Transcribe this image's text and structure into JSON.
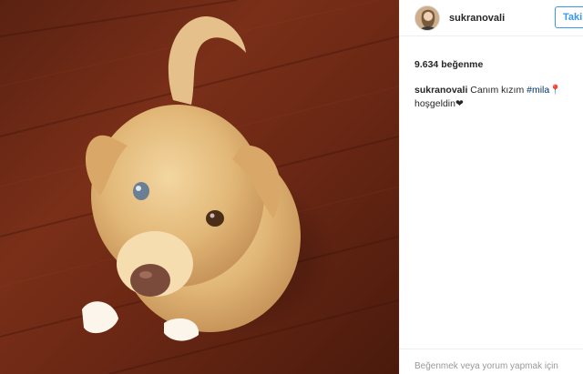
{
  "post": {
    "username": "sukranovali",
    "follow_label": "Takip Et",
    "likes": "9.634 beğenme",
    "caption": {
      "username": "sukranovali",
      "text": " Canım kızım ",
      "hashtag": "#mila",
      "pin": "📍",
      "line2": "hoşgeldin",
      "heart": "❤"
    },
    "footer_hint": "Beğenmek veya yorum yapmak için"
  },
  "colors": {
    "accent": "#3897f0",
    "hashtag": "#003569",
    "text": "#262626",
    "muted": "#999999"
  },
  "icons": [
    "avatar-image",
    "pin-emoji",
    "heart-emoji"
  ]
}
